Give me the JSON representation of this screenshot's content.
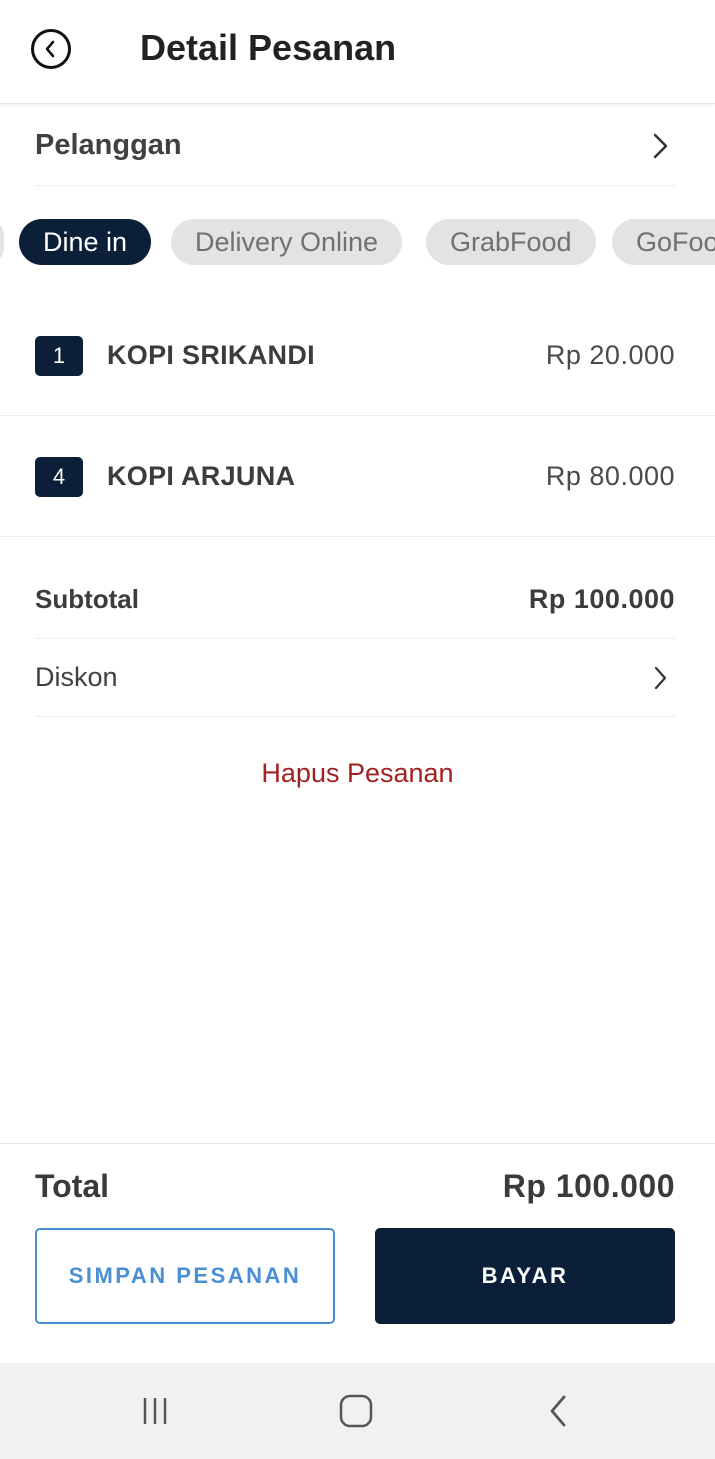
{
  "header": {
    "title": "Detail Pesanan",
    "back_icon": "back-circle-icon"
  },
  "customer": {
    "label": "Pelanggan"
  },
  "order_types": [
    {
      "label": "Dine in",
      "active": true
    },
    {
      "label": "Delivery Online",
      "active": false
    },
    {
      "label": "GrabFood",
      "active": false
    },
    {
      "label": "GoFood",
      "active": false
    }
  ],
  "items": [
    {
      "qty": "1",
      "name": "KOPI SRIKANDI",
      "price": "Rp 20.000"
    },
    {
      "qty": "4",
      "name": "KOPI ARJUNA",
      "price": "Rp 80.000"
    }
  ],
  "summary": {
    "subtotal_label": "Subtotal",
    "subtotal_value": "Rp 100.000",
    "discount_label": "Diskon"
  },
  "delete_label": "Hapus Pesanan",
  "footer": {
    "total_label": "Total",
    "total_value": "Rp 100.000",
    "save_label": "SIMPAN PESANAN",
    "pay_label": "BAYAR"
  },
  "colors": {
    "primary": "#0b1f38",
    "accent": "#4a8fd4",
    "danger": "#a32121",
    "chip_inactive": "#e3e3e3"
  },
  "navbar": {
    "recents_icon": "recents-icon",
    "home_icon": "home-icon",
    "back_icon": "nav-back-icon"
  }
}
